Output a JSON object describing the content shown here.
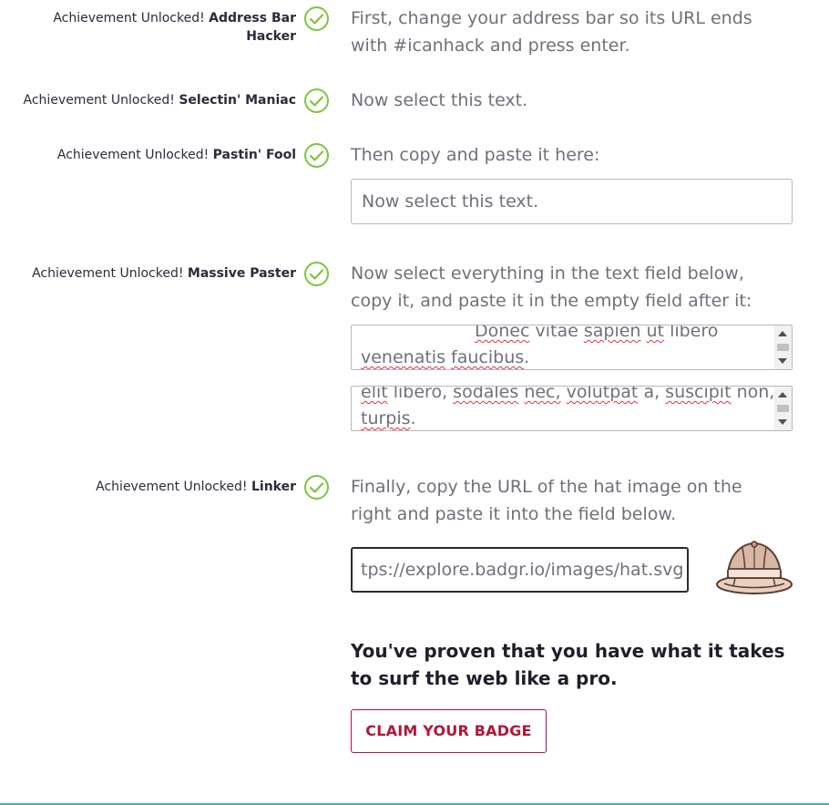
{
  "achievement_prefix": "Achievement Unlocked!",
  "steps": [
    {
      "name": "Address Bar Hacker",
      "name_line1": "Address Bar",
      "name_line2": "Hacker",
      "instruction": "First, change your address bar so its URL ends with #icanhack and press enter."
    },
    {
      "name": "Selectin' Maniac",
      "instruction": "Now select this text."
    },
    {
      "name": "Pastin' Fool",
      "instruction": "Then copy and paste it here:",
      "input_value": "Now select this text."
    },
    {
      "name": "Massive Paster",
      "instruction": "Now select everything in the text field below, copy it, and paste it in the empty field after it:"
    },
    {
      "name": "Linker",
      "instruction": "Finally, copy the URL of the hat image on the right and paste it into the field below.",
      "input_value": "tps://explore.badgr.io/images/hat.svg"
    }
  ],
  "textarea1": {
    "line1": [
      "Donec",
      "vitae",
      "sapien",
      "ut",
      "libero"
    ],
    "line2": [
      "venenatis",
      "faucibus"
    ],
    "line2_end": "."
  },
  "textarea2": {
    "line1": [
      "elit",
      "libero,",
      "sodales",
      "nec,",
      "volutpat",
      "a,",
      "suscipit",
      "non,"
    ],
    "line2": [
      "turpis"
    ],
    "line2_end": "."
  },
  "proven_text": "You've proven that you have what it takes to surf the web like a pro.",
  "claim_button": "CLAIM YOUR BADGE",
  "icons": {
    "check": "check-circle-icon",
    "hat": "pith-helmet-icon"
  },
  "colors": {
    "check": "#7dc43d",
    "accent": "#b0163a",
    "muted_text": "#6f7079",
    "footer_line": "#3cb8a8"
  }
}
